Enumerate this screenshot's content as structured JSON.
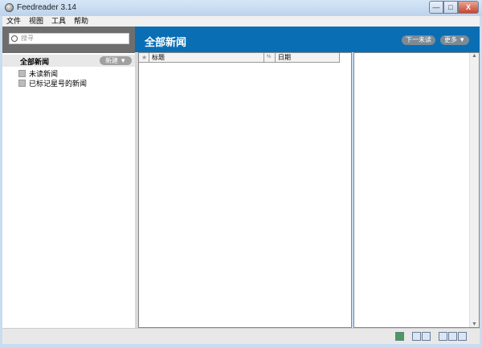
{
  "window": {
    "title": "Feedreader 3.14",
    "minimize": "—",
    "maximize": "□",
    "close": "X"
  },
  "menu": [
    "文件",
    "视图",
    "工具",
    "帮助"
  ],
  "sidebar": {
    "search_placeholder": "搜寻",
    "all_news": "全部新闻",
    "new_button": "新建 ▼",
    "items": [
      {
        "label": "未读新闻"
      },
      {
        "label": "已标记星号的新闻"
      }
    ]
  },
  "main": {
    "title": "全部新闻",
    "next_unread": "下一未读",
    "more": "更多 ▼",
    "columns": {
      "star": "★",
      "title": "标题",
      "attach": "%",
      "date": "日期"
    }
  },
  "reading": {
    "scroll_up": "▲",
    "scroll_down": "▼"
  }
}
